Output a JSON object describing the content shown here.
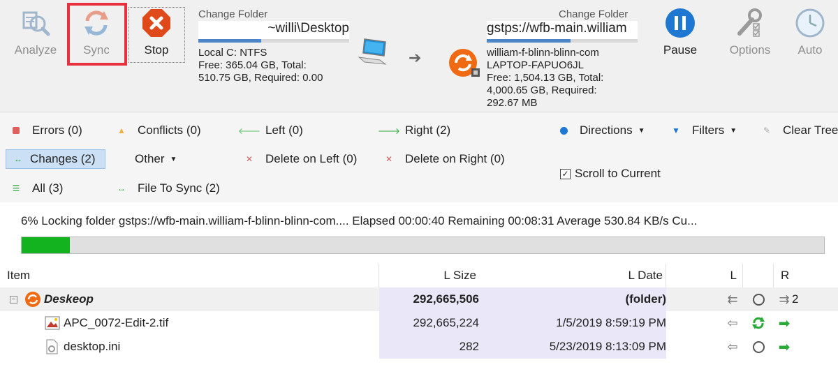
{
  "toolbar": {
    "analyze_label": "Analyze",
    "sync_label": "Sync",
    "stop_label": "Stop",
    "pause_label": "Pause",
    "options_label": "Options",
    "auto_label": "Auto"
  },
  "left_folder": {
    "caption": "Change Folder",
    "path": "~willi\\Desktop",
    "line1": "Local C: NTFS",
    "line2": "Free: 365.04 GB, Total:",
    "line3": "510.75 GB, Required: 0.00"
  },
  "right_folder": {
    "caption": "Change Folder",
    "path": "gstps://wfb-main.william",
    "line1": "william-f-blinn-blinn-com",
    "line2": "LAPTOP-FAPUO6JL",
    "line3": "Free: 1,504.13 GB, Total:",
    "line4": "4,000.65 GB, Required:",
    "line5": "292.67 MB"
  },
  "filters": {
    "errors": "Errors (0)",
    "conflicts": "Conflicts (0)",
    "left": "Left (0)",
    "right": "Right (2)",
    "directions": "Directions",
    "filters": "Filters",
    "clear_tree": "Clear Tree",
    "changes": "Changes (2)",
    "other": "Other",
    "delete_left": "Delete on Left (0)",
    "delete_right": "Delete on Right (0)",
    "scroll_to_current": "Scroll to Current",
    "all": "All (3)",
    "file_to_sync": "File To Sync (2)"
  },
  "status": {
    "text": "6% Locking folder gstps://wfb-main.william-f-blinn-blinn-com....  Elapsed 00:00:40  Remaining 00:08:31  Average 530.84 KB/s  Cu...",
    "progress_percent": 6
  },
  "table": {
    "headers": {
      "item": "Item",
      "lsize": "L Size",
      "ldate": "L Date",
      "l": "L",
      "r": "R"
    },
    "rows": [
      {
        "name": "Deskeop",
        "size": "292,665,506",
        "date": "(folder)",
        "r_count": "2"
      },
      {
        "name": "APC_0072-Edit-2.tif",
        "size": "292,665,224",
        "date": "1/5/2019 8:59:19 PM"
      },
      {
        "name": "desktop.ini",
        "size": "282",
        "date": "5/23/2019 8:13:09 PM"
      }
    ]
  },
  "colors": {
    "accent_blue": "#1e78d2",
    "sync_green": "#2aa838",
    "stop_red": "#e04a1b",
    "highlight_red": "#e8303e"
  }
}
